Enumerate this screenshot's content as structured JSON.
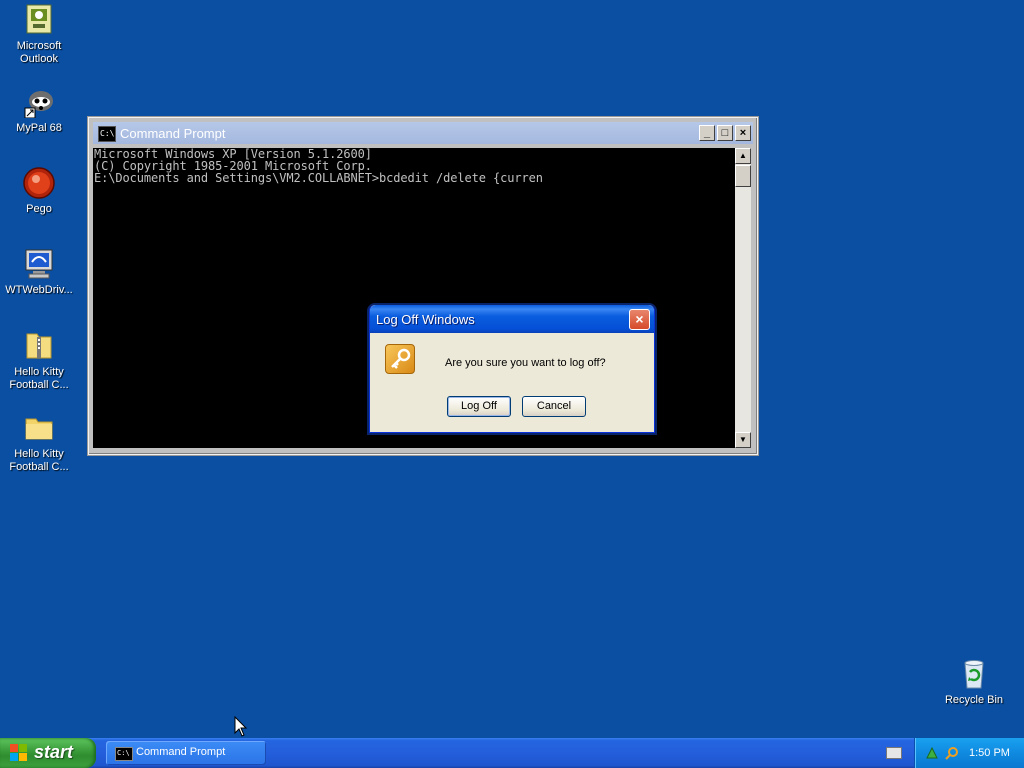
{
  "desktop": {
    "icons": [
      {
        "label": "Microsoft Outlook"
      },
      {
        "label": "MyPal 68"
      },
      {
        "label": "Pego"
      },
      {
        "label": "WTWebDriv..."
      },
      {
        "label": "Hello Kitty Football C..."
      },
      {
        "label": "Hello Kitty Football C..."
      },
      {
        "label": "Recycle Bin"
      }
    ]
  },
  "cmd_window": {
    "title": "Command Prompt",
    "icon_text": "C:\\",
    "buttons": {
      "minimize": "_",
      "maximize": "□",
      "close": "×"
    },
    "lines": [
      "Microsoft Windows XP [Version 5.1.2600]",
      "(C) Copyright 1985-2001 Microsoft Corp.",
      "",
      "E:\\Documents and Settings\\VM2.COLLABNET>bcdedit /delete {curren"
    ]
  },
  "dialog": {
    "title": "Log Off Windows",
    "message": "Are you sure you want to log off?",
    "ok_label": "Log Off",
    "cancel_label": "Cancel",
    "close_glyph": "×"
  },
  "taskbar": {
    "start_label": "start",
    "items": [
      {
        "label": "Command Prompt",
        "icon_text": "C:\\"
      }
    ],
    "clock": "1:50 PM"
  },
  "colors": {
    "desktop": "#0a4fa2",
    "taskbar": "#245edb",
    "start_button": "#3c9e3c",
    "dialog_title": "#0a5ddf"
  },
  "icon_names": [
    "outlook-icon",
    "mypal-icon",
    "pego-icon",
    "webdriver-icon",
    "zip-folder-icon",
    "folder-icon",
    "recycle-bin-icon",
    "key-icon",
    "windows-flag-icon",
    "keyboard-icon",
    "network-icon",
    "search-icon"
  ]
}
